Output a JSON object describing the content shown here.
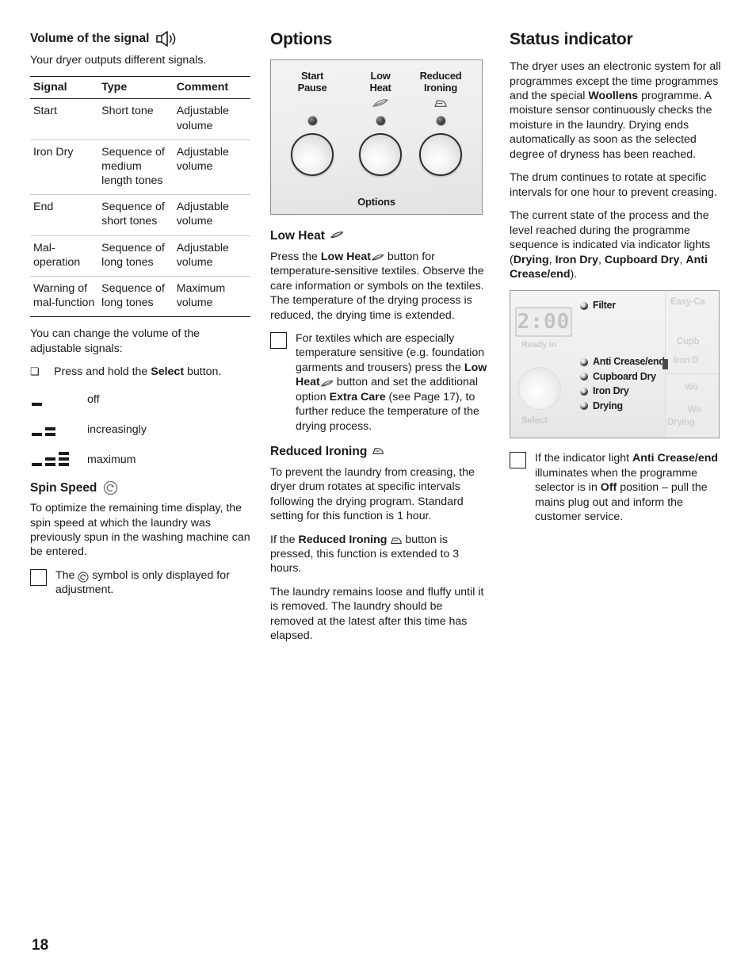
{
  "page_number": "18",
  "left_column": {
    "heading": "Volume of the signal",
    "heading_icon": "speaker-icon",
    "intro": "Your dryer outputs different signals.",
    "table": {
      "headers": [
        "Signal",
        "Type",
        "Comment"
      ],
      "rows": [
        {
          "signal": "Start",
          "type": "Short tone",
          "comment": "Adjustable volume"
        },
        {
          "signal": "Iron Dry",
          "type": "Sequence of medium length tones",
          "comment": "Adjustable volume"
        },
        {
          "signal": "End",
          "type": "Sequence of short tones",
          "comment": "Adjustable volume"
        },
        {
          "signal": "Mal-operation",
          "type": "Sequence of long tones",
          "comment": "Adjustable volume"
        },
        {
          "signal": "Warning of mal-function",
          "type": "Sequence of long tones",
          "comment": "Maximum volume"
        }
      ]
    },
    "change_volume_text": "You can change the volume of the adjustable signals:",
    "bullet": {
      "prefix": "Press and hold the ",
      "bold": "Select",
      "suffix": " button."
    },
    "levels": [
      {
        "label": "off",
        "bars": 1
      },
      {
        "label": "increasingly",
        "bars": 2
      },
      {
        "label": "maximum",
        "bars": 3
      }
    ],
    "spin_speed": {
      "heading": "Spin Speed",
      "heading_icon": "spiral-icon",
      "body": "To optimize the remaining time display, the spin speed at which the laundry was previously spun in the washing machine can be entered.",
      "note_prefix": "The ",
      "note_icon": "spiral-icon",
      "note_suffix": " symbol is only displayed for adjustment."
    }
  },
  "middle_column": {
    "heading": "Options",
    "panel": {
      "buttons": [
        {
          "line1": "Start",
          "line2": "Pause",
          "icon": ""
        },
        {
          "line1": "Low",
          "line2": "Heat",
          "icon": "feather-icon"
        },
        {
          "line1": "Reduced",
          "line2": "Ironing",
          "icon": "iron-icon"
        }
      ],
      "footer": "Options"
    },
    "low_heat": {
      "heading": "Low Heat",
      "heading_icon": "feather-icon",
      "para_1a": "Press the ",
      "para_1b": "Low Heat",
      "para_1c": " button for temperature-sensitive textiles. Observe the care information or symbols on the textiles. The temperature of the drying process is reduced, the drying time is extended.",
      "note_a": "For textiles which are especially temperature sensitive (e.g. foundation garments and trousers) press the ",
      "note_b": "Low Heat",
      "note_c": " button and set the additional option ",
      "note_d": "Extra Care",
      "note_e": " (see Page 17), to further reduce the temperature of the drying process."
    },
    "reduced_ironing": {
      "heading": "Reduced Ironing",
      "heading_icon": "iron-icon",
      "para_1": "To prevent the laundry from creasing, the dryer drum rotates at specific intervals following the drying program. Standard setting for this function is 1 hour.",
      "para_2a": "If the ",
      "para_2b": "Reduced Ironing",
      "para_2c": " button is pressed, this function is extended to 3 hours.",
      "para_3": "The laundry remains loose and fluffy until it is removed. The laundry should be removed at the latest after this time has elapsed."
    }
  },
  "right_column": {
    "heading": "Status indicator",
    "para_1a": "The dryer uses an electronic system for all programmes except the time programmes and the special ",
    "para_1b": "Woollens",
    "para_1c": " programme. A moisture sensor continuously checks the moisture in the laundry. Drying ends automatically as soon as the selected degree of dryness has been reached.",
    "para_2": "The drum continues to rotate at specific intervals for one hour to prevent creasing.",
    "para_3a": "The current state of the process and the level reached during the programme sequence is indicated via indicator lights (",
    "para_3_b1": "Drying",
    "para_3_sep1": ", ",
    "para_3_b2": "Iron Dry",
    "para_3_sep2": ", ",
    "para_3_b3": "Cupboard Dry",
    "para_3_sep3": ", ",
    "para_3_b4": "Anti Crease/end",
    "para_3_end": ").",
    "panel": {
      "display_value": "2:00",
      "ready_in_label": "Ready in",
      "select_label": "Select",
      "filter_label": "Filter",
      "indicators": [
        "Anti Crease/end",
        "Cupboard Dry",
        "Iron Dry",
        "Drying"
      ],
      "right_labels": [
        "Easy-Ca",
        "Cupb",
        "Iron D",
        "Wo",
        "Wo",
        "Drying"
      ]
    },
    "note_a": "If the indicator light ",
    "note_b": "Anti Crease/end",
    "note_c": " illuminates when the programme selector is in ",
    "note_d": "Off",
    "note_e": " position – pull the mains plug out and inform the customer service."
  }
}
